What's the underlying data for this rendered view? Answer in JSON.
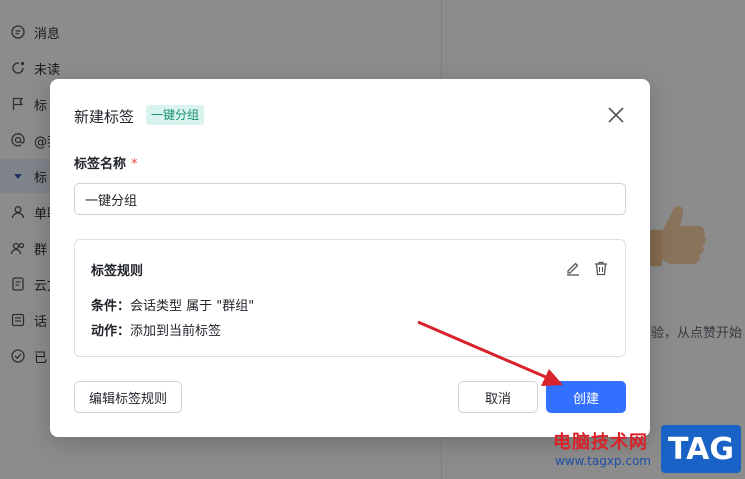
{
  "sidebar": {
    "items": [
      {
        "label": "消息",
        "icon": "chat-icon"
      },
      {
        "label": "未读",
        "icon": "unread-icon"
      },
      {
        "label": "标",
        "icon": "flag-icon"
      },
      {
        "label": "@我",
        "icon": "at-icon"
      },
      {
        "label": "标",
        "icon": "caret-down-icon"
      },
      {
        "label": "单聊",
        "icon": "user-icon"
      },
      {
        "label": "群",
        "icon": "group-icon"
      },
      {
        "label": "云文",
        "icon": "doc-icon"
      },
      {
        "label": "话",
        "icon": "topic-icon"
      },
      {
        "label": "已",
        "icon": "check-circle-icon"
      }
    ]
  },
  "right_pane": {
    "hint": "验，从点赞开始"
  },
  "dialog": {
    "title": "新建标签",
    "tag": "一键分组",
    "name_label": "标签名称",
    "required_mark": "*",
    "name_value": "一键分组",
    "rule": {
      "title": "标签规则",
      "condition_label": "条件：",
      "condition_value": "会话类型 属于 \"群组\"",
      "action_label": "动作：",
      "action_value": "添加到当前标签"
    },
    "edit_rules_button": "编辑标签规则",
    "cancel_button": "取消",
    "create_button": "创建"
  },
  "watermark": {
    "site_name": "电脑技术网",
    "url": "www.tagxp.com",
    "logo": "TAG"
  },
  "colors": {
    "primary": "#3370ff",
    "tag_bg": "#d9f4ee",
    "tag_text": "#1a8f6f",
    "required": "#f54a45",
    "annotation_arrow": "#d8232a"
  }
}
